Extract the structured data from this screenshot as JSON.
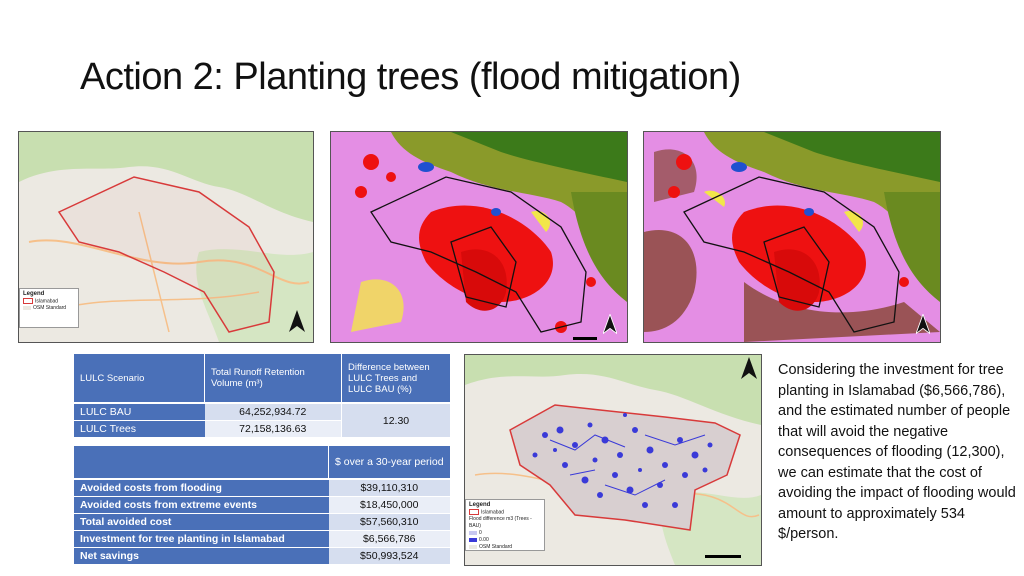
{
  "slide": {
    "title": "Action 2: Planting trees (flood mitigation)"
  },
  "maps": {
    "legend_title": "Legend",
    "legend_items_basemap": [
      "Islamabad",
      "OSM Standard"
    ],
    "legend_items_flood": [
      "Islamabad",
      "Flood difference m3 (Trees - BAU)",
      "0",
      "0.00",
      "OSM Standard"
    ],
    "colors": {
      "boundary_red": "#d83a3a",
      "boundary_black": "#111111",
      "urban_red": "#ee1111",
      "pink": "#e48ee4",
      "forest_green": "#3c7a1a",
      "olive": "#8a9a2a",
      "brown": "#7a3a1a",
      "yellow": "#f2e64a",
      "water_blue": "#2050d0",
      "flood_blue": "#3a3ad8",
      "basemap_bg": "#ece9e2",
      "basemap_green": "#c8dfb0"
    },
    "icons": [
      "north-arrow-icon"
    ]
  },
  "table1": {
    "headers": [
      "LULC Scenario",
      "Total Runoff Retention Volume (m³)",
      "Difference between LULC Trees and LULC BAU (%)"
    ],
    "rows": [
      {
        "scenario": "LULC BAU",
        "volume": "64,252,934.72"
      },
      {
        "scenario": "LULC Trees",
        "volume": "72,158,136.63"
      }
    ],
    "difference": "12.30"
  },
  "table2": {
    "header": "$ over a 30-year period",
    "rows": [
      {
        "label": "Avoided costs from flooding",
        "value": "$39,110,310"
      },
      {
        "label": "Avoided costs from extreme events",
        "value": "$18,450,000"
      },
      {
        "label": "Total avoided cost",
        "value": "$57,560,310"
      },
      {
        "label": "Investment for tree planting in Islamabad",
        "value": "$6,566,786"
      },
      {
        "label": "Net savings",
        "value": "$50,993,524"
      }
    ]
  },
  "side_text": "Considering the investment for tree planting in Islamabad ($6,566,786), and the estimated number of people that will avoid the negative consequences of flooding (12,300), we can estimate that the cost of avoiding the impact of flooding would amount to approximately 534 $/person."
}
